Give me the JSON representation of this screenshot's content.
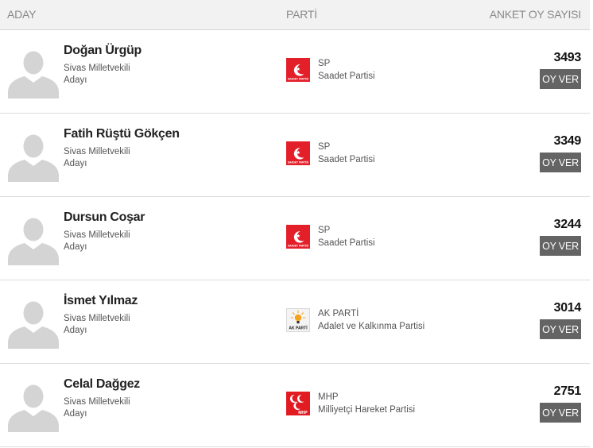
{
  "header": {
    "candidate_col": "ADAY",
    "party_col": "PARTİ",
    "votes_col": "ANKET OY SAYISI"
  },
  "candidates": [
    {
      "name": "Doğan Ürgüp",
      "role_line1": "Sivas Milletvekili",
      "role_line2": "Adayı",
      "party_abbr": "SP",
      "party_name": "Saadet Partisi",
      "party_logo": "saadet",
      "votes": "3493",
      "vote_label": "OY VER"
    },
    {
      "name": "Fatih Rüştü Gökçen",
      "role_line1": "Sivas Milletvekili",
      "role_line2": "Adayı",
      "party_abbr": "SP",
      "party_name": "Saadet Partisi",
      "party_logo": "saadet",
      "votes": "3349",
      "vote_label": "OY VER"
    },
    {
      "name": "Dursun Coşar",
      "role_line1": "Sivas Milletvekili",
      "role_line2": "Adayı",
      "party_abbr": "SP",
      "party_name": "Saadet Partisi",
      "party_logo": "saadet",
      "votes": "3244",
      "vote_label": "OY VER"
    },
    {
      "name": "İsmet Yılmaz",
      "role_line1": "Sivas Milletvekili",
      "role_line2": "Adayı",
      "party_abbr": "AK PARTİ",
      "party_name": "Adalet ve Kalkınma Partisi",
      "party_logo": "akparti",
      "votes": "3014",
      "vote_label": "OY VER"
    },
    {
      "name": "Celal Dağgez",
      "role_line1": "Sivas Milletvekili",
      "role_line2": "Adayı",
      "party_abbr": "MHP",
      "party_name": "Milliyetçi Hareket Partisi",
      "party_logo": "mhp",
      "votes": "2751",
      "vote_label": "OY VER"
    }
  ],
  "logos": {
    "saadet_text": "SAADET PARTİSİ",
    "akparti_text": "AK PARTİ",
    "mhp_text": "MHP"
  },
  "colors": {
    "header_bg": "#f2f2f2",
    "button_bg": "#646464",
    "saadet_red": "#e3202a",
    "mhp_red": "#e21b23",
    "akparti_yellow": "#f6a31b",
    "avatar_gray": "#d4d4d4"
  }
}
